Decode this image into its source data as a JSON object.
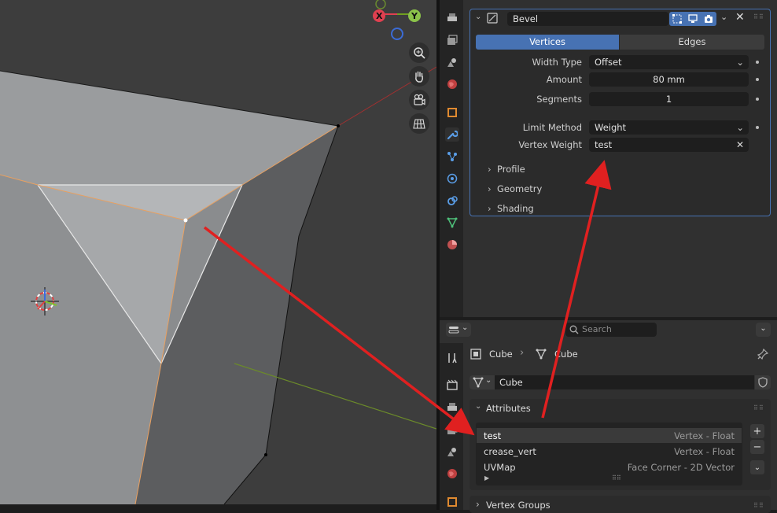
{
  "viewport": {
    "gizmo": {
      "x_label": "X",
      "y_label": "Y"
    },
    "nav_buttons": [
      "zoom-icon",
      "hand-icon",
      "camera-icon",
      "grid-icon"
    ]
  },
  "modifier": {
    "name": "Bevel",
    "tabs": {
      "vertices": "Vertices",
      "edges": "Edges",
      "active": "vertices"
    },
    "width_type": {
      "label": "Width Type",
      "value": "Offset"
    },
    "amount": {
      "label": "Amount",
      "value": "80 mm"
    },
    "segments": {
      "label": "Segments",
      "value": "1"
    },
    "limit_method": {
      "label": "Limit Method",
      "value": "Weight"
    },
    "vertex_weight": {
      "label": "Vertex Weight",
      "value": "test"
    },
    "subpanels": [
      "Profile",
      "Geometry",
      "Shading"
    ]
  },
  "bottom": {
    "search_placeholder": "Search",
    "breadcrumb": {
      "object": "Cube",
      "mesh": "Cube"
    },
    "mesh_name": "Cube",
    "attributes": {
      "title": "Attributes",
      "items": [
        {
          "name": "test",
          "type": "Vertex - Float"
        },
        {
          "name": "crease_vert",
          "type": "Vertex - Float"
        },
        {
          "name": "UVMap",
          "type": "Face Corner - 2D Vector"
        }
      ]
    },
    "vertex_groups_title": "Vertex Groups"
  },
  "colors": {
    "accent": "#4772b3",
    "annotation_arrow": "#e02020",
    "selected_edge": "#e8a060"
  }
}
